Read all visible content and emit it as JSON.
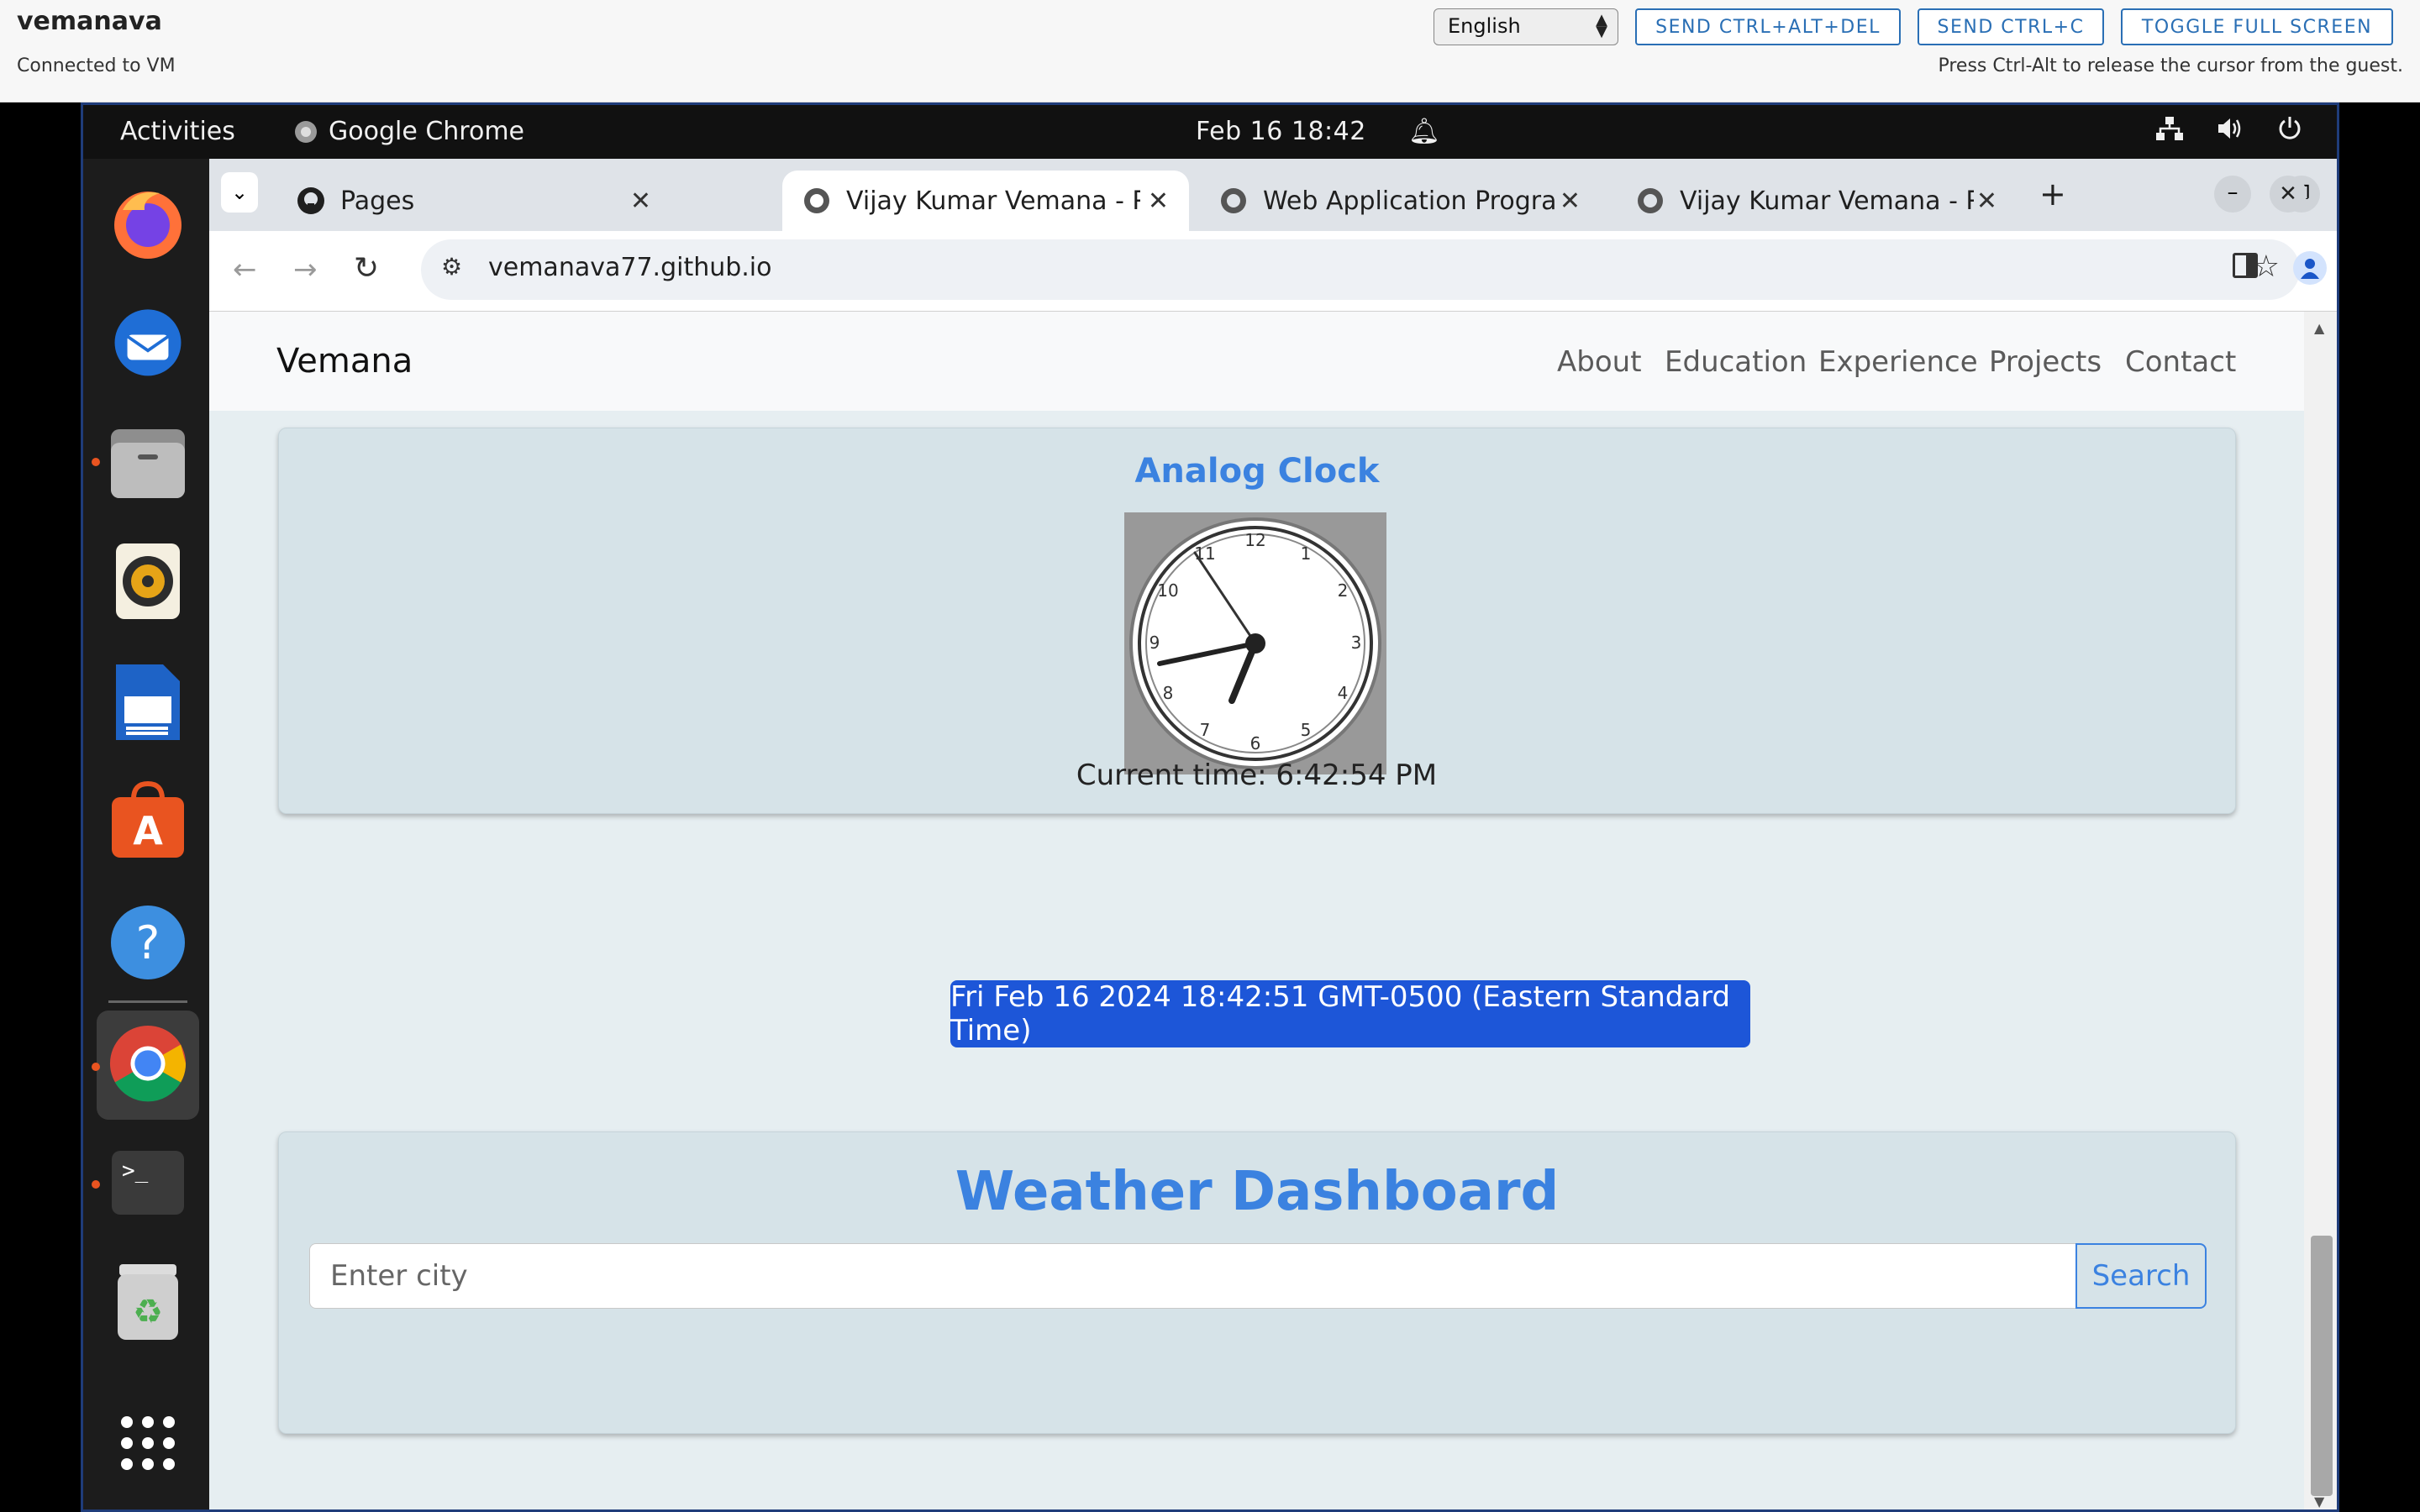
{
  "vm": {
    "name": "vemanava",
    "status": "Connected to VM",
    "language": "English",
    "buttons": [
      "SEND CTRL+ALT+DEL",
      "SEND CTRL+C",
      "TOGGLE FULL SCREEN"
    ],
    "hint": "Press Ctrl-Alt to release the cursor from the guest."
  },
  "gnome": {
    "activities": "Activities",
    "app_name": "Google Chrome",
    "clock": "Feb 16  18:42"
  },
  "chrome": {
    "tabs": [
      {
        "title": "Pages",
        "icon": "github-icon"
      },
      {
        "title": "Vijay Kumar Vemana - Pr",
        "icon": "globe-icon"
      },
      {
        "title": "Web Application Progra",
        "icon": "globe-icon"
      },
      {
        "title": "Vijay Kumar Vemana - Pr",
        "icon": "globe-icon"
      }
    ],
    "url": "vemanava77.github.io"
  },
  "site": {
    "brand": "Vemana",
    "nav": [
      "About",
      "Education",
      "Experience",
      "Projects",
      "Contact"
    ],
    "clock_title": "Analog Clock",
    "current_time": "Current time: 6:42:54 PM",
    "date_button": "Fri Feb 16 2024 18:42:51 GMT-0500 (Eastern Standard Time)",
    "weather_title": "Weather Dashboard",
    "city_placeholder": "Enter city",
    "search_label": "Search"
  },
  "colors": {
    "accent": "#3b82e0",
    "date_button": "#1d56d8",
    "ubuntu_orange": "#e95420"
  }
}
